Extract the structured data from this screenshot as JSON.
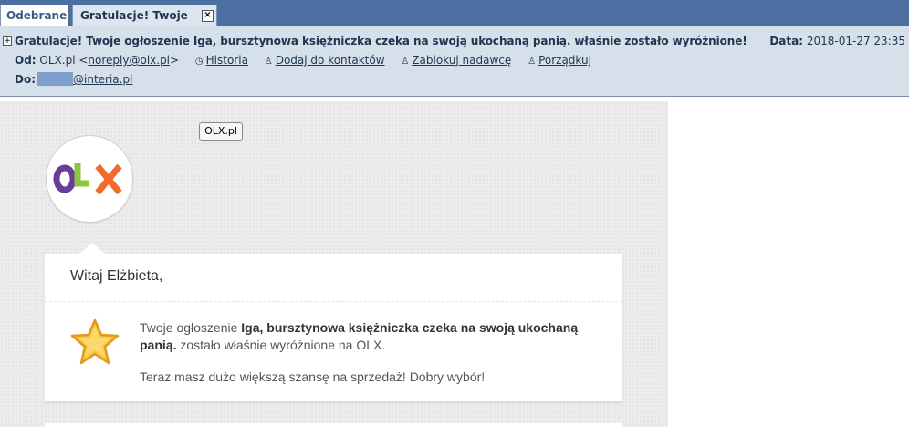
{
  "tabs": {
    "inbox": "Odebrane",
    "message": "Gratulacje! Twoje og...",
    "close": "×"
  },
  "header": {
    "expand": "+",
    "subject": "Gratulacje! Twoje ogłoszenie Iga, bursztynowa księżniczka czeka na swoją ukochaną panią. właśnie zostało wyróżnione!",
    "date_label": "Data:",
    "date_value": "2018-01-27 23:35",
    "from_label": "Od:",
    "from_name": "OLX.pl",
    "from_email": "noreply@olx.pl",
    "actions": {
      "history": "Historia",
      "add_contact": "Dodaj do kontaktów",
      "block": "Zablokuj nadawcę",
      "tidy": "Porządkuj"
    },
    "to_label": "Do:",
    "to_domain": "@interia.pl"
  },
  "email": {
    "tooltip": "OLX.pl",
    "logo_text": "OLX",
    "greeting": "Witaj Elżbieta,",
    "msg_prefix": "Twoje ogłoszenie ",
    "msg_title": "Iga, bursztynowa księżniczka czeka na swoją ukochaną panią.",
    "msg_suffix": " zostało właśnie wyróżnione na OLX.",
    "msg_second": "Teraz masz dużo większą szansę na sprzedaż! Dobry wybór!"
  },
  "colors": {
    "tabbar": "#4a6fa0",
    "header_bg": "#d6e0ea",
    "header_text": "#1f3550",
    "olx_purple": "#6b3c97",
    "olx_green": "#8cc63f",
    "olx_orange": "#f26b2c",
    "star": "#f7b42c"
  }
}
